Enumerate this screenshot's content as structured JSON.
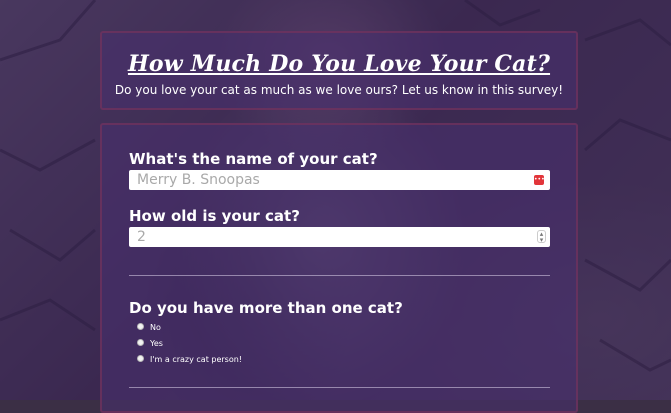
{
  "header": {
    "title": "How Much Do You Love Your Cat?",
    "subtitle": "Do you love your cat as much as we love ours? Let us know in this survey!"
  },
  "form": {
    "name_label": "What's the name of your cat?",
    "name_placeholder": "Merry B. Snoopas",
    "age_label": "How old is your cat?",
    "age_placeholder": "2",
    "multi_label": "Do you have more than one cat?",
    "options": [
      {
        "label": "No"
      },
      {
        "label": "Yes"
      },
      {
        "label": "I'm a crazy cat person!"
      }
    ]
  },
  "colors": {
    "overlay": "#3a225c",
    "card_border": "#78325a",
    "autofill_icon": "#e2353a"
  },
  "icons": {
    "name_field": "autofill-icon",
    "age_field": "number-spinner-icon"
  }
}
